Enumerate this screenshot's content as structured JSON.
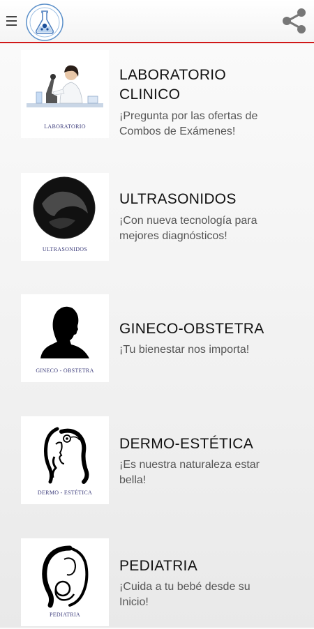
{
  "toolbar": {
    "menu_icon": "hamburger-menu-icon",
    "logo_icon": "lab-flask-logo",
    "share_icon": "share-icon",
    "accent_color": "#d01818"
  },
  "services": [
    {
      "title_lines": [
        "LABORATORIO",
        "CLINICO"
      ],
      "desc_lines": [
        "¡Pregunta por las ofertas de",
        "Combos de Exámenes!"
      ],
      "caption": "LABORATORIO"
    },
    {
      "title_lines": [
        "ULTRASONIDOS"
      ],
      "desc_lines": [
        "¡Con nueva tecnología para",
        "mejores diagnósticos!"
      ],
      "caption": "ULTRASONIDOS"
    },
    {
      "title_lines": [
        "GINECO-OBSTETRA"
      ],
      "desc_lines": [
        "¡Tu bienestar nos importa!"
      ],
      "caption": "GINECO - OBSTETRA"
    },
    {
      "title_lines": [
        "DERMO-ESTÉTICA"
      ],
      "desc_lines": [
        "¡Es nuestra naturaleza estar",
        "bella!"
      ],
      "caption": "DERMO - ESTÉTICA"
    },
    {
      "title_lines": [
        "PEDIATRIA"
      ],
      "desc_lines": [
        "¡Cuida a tu bebé desde su",
        "Inicio!"
      ],
      "caption": "PEDIATRIA"
    }
  ]
}
